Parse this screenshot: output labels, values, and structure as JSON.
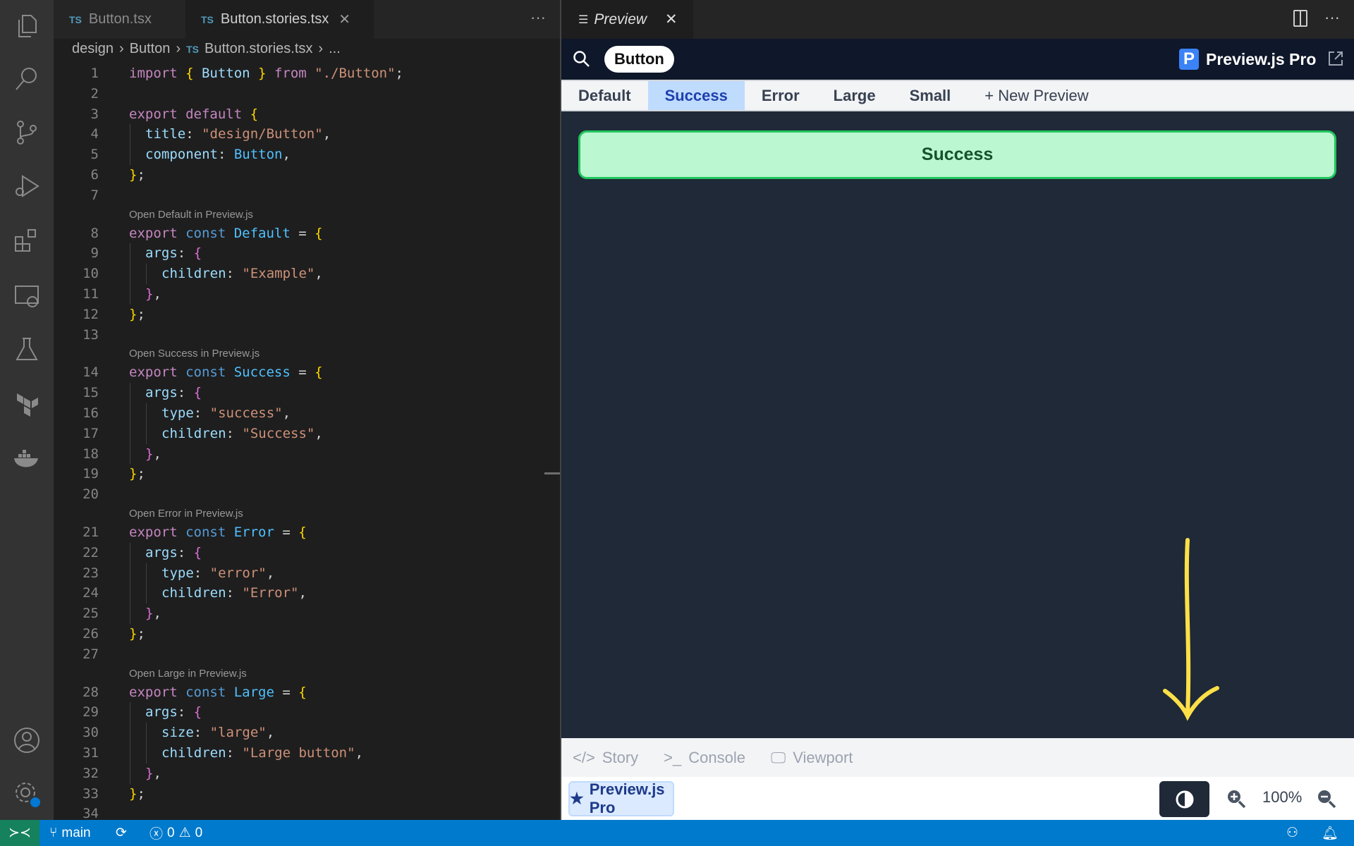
{
  "editor_tabs": [
    {
      "label": "Button.tsx",
      "lang": "TS",
      "active": false
    },
    {
      "label": "Button.stories.tsx",
      "lang": "TS",
      "active": true
    }
  ],
  "breadcrumb": {
    "items": [
      "design",
      "Button"
    ],
    "lang": "TS",
    "file": "Button.stories.tsx",
    "more": "..."
  },
  "code": [
    {
      "n": "1",
      "t": [
        [
          "kw",
          "import "
        ],
        [
          "br",
          "{ "
        ],
        [
          "id",
          "Button "
        ],
        [
          "br",
          "} "
        ],
        [
          "kw",
          "from "
        ],
        [
          "st",
          "\"./Button\""
        ],
        [
          "pl",
          ";"
        ]
      ]
    },
    {
      "n": "2",
      "t": []
    },
    {
      "n": "3",
      "t": [
        [
          "kw",
          "export default "
        ],
        [
          "br",
          "{"
        ]
      ]
    },
    {
      "n": "4",
      "g": 1,
      "t": [
        [
          "id",
          "title"
        ],
        [
          "pl",
          ": "
        ],
        [
          "st",
          "\"design/Button\""
        ],
        [
          "pl",
          ","
        ]
      ]
    },
    {
      "n": "5",
      "g": 1,
      "t": [
        [
          "id",
          "component"
        ],
        [
          "pl",
          ": "
        ],
        [
          "cn",
          "Button"
        ],
        [
          "pl",
          ","
        ]
      ]
    },
    {
      "n": "6",
      "t": [
        [
          "br",
          "}"
        ],
        [
          "pl",
          ";"
        ]
      ]
    },
    {
      "n": "7",
      "t": []
    },
    {
      "lens": "Open Default in Preview.js"
    },
    {
      "n": "8",
      "t": [
        [
          "kw",
          "export "
        ],
        [
          "vr",
          "const "
        ],
        [
          "cn",
          "Default "
        ],
        [
          "pl",
          "= "
        ],
        [
          "br",
          "{"
        ]
      ]
    },
    {
      "n": "9",
      "g": 1,
      "t": [
        [
          "id",
          "args"
        ],
        [
          "pl",
          ": "
        ],
        [
          "br2",
          "{"
        ]
      ]
    },
    {
      "n": "10",
      "g": 2,
      "t": [
        [
          "id",
          "children"
        ],
        [
          "pl",
          ": "
        ],
        [
          "st",
          "\"Example\""
        ],
        [
          "pl",
          ","
        ]
      ]
    },
    {
      "n": "11",
      "g": 1,
      "t": [
        [
          "br2",
          "}"
        ],
        [
          "pl",
          ","
        ]
      ]
    },
    {
      "n": "12",
      "t": [
        [
          "br",
          "}"
        ],
        [
          "pl",
          ";"
        ]
      ]
    },
    {
      "n": "13",
      "t": []
    },
    {
      "lens": "Open Success in Preview.js"
    },
    {
      "n": "14",
      "t": [
        [
          "kw",
          "export "
        ],
        [
          "vr",
          "const "
        ],
        [
          "cn",
          "Success "
        ],
        [
          "pl",
          "= "
        ],
        [
          "br",
          "{"
        ]
      ]
    },
    {
      "n": "15",
      "g": 1,
      "t": [
        [
          "id",
          "args"
        ],
        [
          "pl",
          ": "
        ],
        [
          "br2",
          "{"
        ]
      ]
    },
    {
      "n": "16",
      "g": 2,
      "t": [
        [
          "id",
          "type"
        ],
        [
          "pl",
          ": "
        ],
        [
          "st",
          "\"success\""
        ],
        [
          "pl",
          ","
        ]
      ]
    },
    {
      "n": "17",
      "g": 2,
      "t": [
        [
          "id",
          "children"
        ],
        [
          "pl",
          ": "
        ],
        [
          "st",
          "\"Success\""
        ],
        [
          "pl",
          ","
        ]
      ]
    },
    {
      "n": "18",
      "g": 1,
      "t": [
        [
          "br2",
          "}"
        ],
        [
          "pl",
          ","
        ]
      ]
    },
    {
      "n": "19",
      "t": [
        [
          "br",
          "}"
        ],
        [
          "pl",
          ";"
        ]
      ]
    },
    {
      "n": "20",
      "t": []
    },
    {
      "lens": "Open Error in Preview.js"
    },
    {
      "n": "21",
      "t": [
        [
          "kw",
          "export "
        ],
        [
          "vr",
          "const "
        ],
        [
          "cn",
          "Error "
        ],
        [
          "pl",
          "= "
        ],
        [
          "br",
          "{"
        ]
      ]
    },
    {
      "n": "22",
      "g": 1,
      "t": [
        [
          "id",
          "args"
        ],
        [
          "pl",
          ": "
        ],
        [
          "br2",
          "{"
        ]
      ]
    },
    {
      "n": "23",
      "g": 2,
      "t": [
        [
          "id",
          "type"
        ],
        [
          "pl",
          ": "
        ],
        [
          "st",
          "\"error\""
        ],
        [
          "pl",
          ","
        ]
      ]
    },
    {
      "n": "24",
      "g": 2,
      "t": [
        [
          "id",
          "children"
        ],
        [
          "pl",
          ": "
        ],
        [
          "st",
          "\"Error\""
        ],
        [
          "pl",
          ","
        ]
      ]
    },
    {
      "n": "25",
      "g": 1,
      "t": [
        [
          "br2",
          "}"
        ],
        [
          "pl",
          ","
        ]
      ]
    },
    {
      "n": "26",
      "t": [
        [
          "br",
          "}"
        ],
        [
          "pl",
          ";"
        ]
      ]
    },
    {
      "n": "27",
      "t": []
    },
    {
      "lens": "Open Large in Preview.js"
    },
    {
      "n": "28",
      "t": [
        [
          "kw",
          "export "
        ],
        [
          "vr",
          "const "
        ],
        [
          "cn",
          "Large "
        ],
        [
          "pl",
          "= "
        ],
        [
          "br",
          "{"
        ]
      ]
    },
    {
      "n": "29",
      "g": 1,
      "t": [
        [
          "id",
          "args"
        ],
        [
          "pl",
          ": "
        ],
        [
          "br2",
          "{"
        ]
      ]
    },
    {
      "n": "30",
      "g": 2,
      "t": [
        [
          "id",
          "size"
        ],
        [
          "pl",
          ": "
        ],
        [
          "st",
          "\"large\""
        ],
        [
          "pl",
          ","
        ]
      ]
    },
    {
      "n": "31",
      "g": 2,
      "t": [
        [
          "id",
          "children"
        ],
        [
          "pl",
          ": "
        ],
        [
          "st",
          "\"Large button\""
        ],
        [
          "pl",
          ","
        ]
      ]
    },
    {
      "n": "32",
      "g": 1,
      "t": [
        [
          "br2",
          "}"
        ],
        [
          "pl",
          ","
        ]
      ]
    },
    {
      "n": "33",
      "t": [
        [
          "br",
          "}"
        ],
        [
          "pl",
          ";"
        ]
      ]
    },
    {
      "n": "34",
      "t": []
    }
  ],
  "preview": {
    "tab_label": "Preview",
    "component_pill": "Button",
    "brand": "Preview.js Pro",
    "brand_logo": "P",
    "stories": [
      "Default",
      "Success",
      "Error",
      "Large",
      "Small"
    ],
    "active_story": "Success",
    "new_preview": "+ New Preview",
    "rendered_button": "Success",
    "bottom_tabs": [
      "Story",
      "Console",
      "Viewport"
    ],
    "pro_button": "Preview.js Pro",
    "zoom": "100%"
  },
  "status": {
    "branch": "main",
    "errors": "0",
    "warnings": "0"
  },
  "colors": {
    "accent": "#007acc",
    "success_bg": "#bbf7d0",
    "success_border": "#22c55e",
    "arrow": "#fde047"
  }
}
